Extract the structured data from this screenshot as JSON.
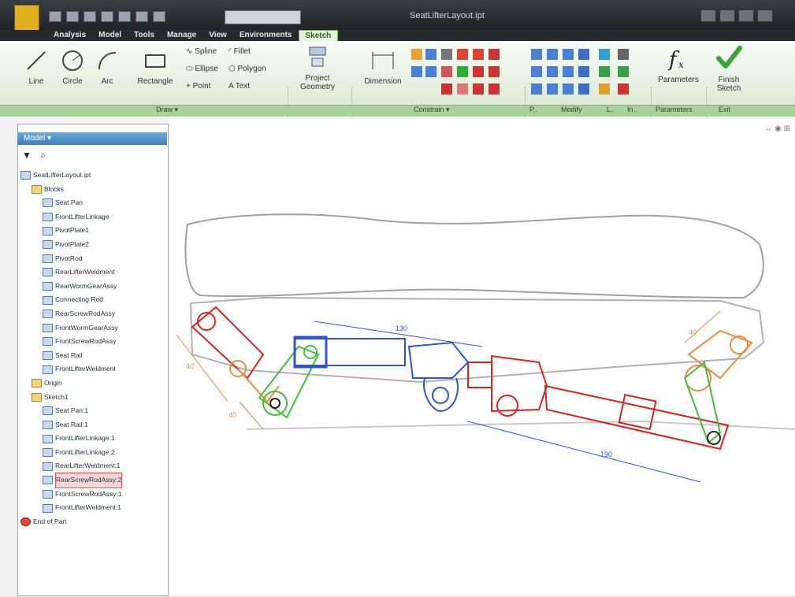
{
  "window": {
    "title": "SeatLifterLayout.ipt"
  },
  "ribbon_tabs": [
    "Analysis",
    "Model",
    "Tools",
    "Manage",
    "View",
    "Environments",
    "Sketch"
  ],
  "ribbon": {
    "draw": {
      "line": "Line",
      "circle": "Circle",
      "arc": "Arc",
      "rectangle": "Rectangle",
      "spline": "Spline",
      "fillet": "Fillet",
      "ellipse": "Ellipse",
      "polygon": "Polygon",
      "point": "Point",
      "text": "Text",
      "project_geometry": "Project Geometry"
    },
    "constrain": {
      "dimension": "Dimension"
    },
    "parameters": "Parameters",
    "finish_sketch": "Finish Sketch"
  },
  "panels": {
    "draw": "Draw ▾",
    "constrain": "Constrain ▾",
    "pattern": "P..",
    "modify": "Modify",
    "layout": "L..",
    "insert": "In..",
    "parameters": "Parameters",
    "exit": "Exit"
  },
  "browser": {
    "title": "Model ▾",
    "items": [
      {
        "label": "SeatLifterLayout.ipt",
        "indent": 0,
        "type": "part"
      },
      {
        "label": "Blocks",
        "indent": 1,
        "type": "folder"
      },
      {
        "label": "Seat Pan",
        "indent": 2,
        "type": "block"
      },
      {
        "label": "FrontLifterLinkage",
        "indent": 2,
        "type": "block"
      },
      {
        "label": "PivotPlate1",
        "indent": 2,
        "type": "block"
      },
      {
        "label": "PivotPlate2",
        "indent": 2,
        "type": "block"
      },
      {
        "label": "PivotRod",
        "indent": 2,
        "type": "block"
      },
      {
        "label": "RearLifterWeldment",
        "indent": 2,
        "type": "block"
      },
      {
        "label": "RearWormGearAssy",
        "indent": 2,
        "type": "block"
      },
      {
        "label": "Connecting Rod",
        "indent": 2,
        "type": "block"
      },
      {
        "label": "RearScrewRodAssy",
        "indent": 2,
        "type": "block"
      },
      {
        "label": "FrontWormGearAssy",
        "indent": 2,
        "type": "block"
      },
      {
        "label": "FrontScrewRodAssy",
        "indent": 2,
        "type": "block"
      },
      {
        "label": "Seat Rail",
        "indent": 2,
        "type": "block"
      },
      {
        "label": "FrontLifterWeldment",
        "indent": 2,
        "type": "block"
      },
      {
        "label": "Origin",
        "indent": 1,
        "type": "folder"
      },
      {
        "label": "Sketch1",
        "indent": 1,
        "type": "folder"
      },
      {
        "label": "Seat Pan:1",
        "indent": 2,
        "type": "block"
      },
      {
        "label": "Seat Rail:1",
        "indent": 2,
        "type": "block"
      },
      {
        "label": "FrontLifterLinkage:1",
        "indent": 2,
        "type": "block"
      },
      {
        "label": "FrontLifterLinkage:2",
        "indent": 2,
        "type": "block"
      },
      {
        "label": "RearLifterWeldment:1",
        "indent": 2,
        "type": "block"
      },
      {
        "label": "RearScrewRodAssy:2",
        "indent": 2,
        "type": "block",
        "selected": true
      },
      {
        "label": "FrontScrewRodAssy:1",
        "indent": 2,
        "type": "block"
      },
      {
        "label": "FrontLifterWeldment:1",
        "indent": 2,
        "type": "block"
      },
      {
        "label": "End of Part",
        "indent": 0,
        "type": "end"
      }
    ]
  },
  "dimensions": [
    "130",
    "190",
    "40",
    "40",
    "40"
  ],
  "colors": {
    "ribbon_green": "#a9d39a",
    "blue": "#2b55d6",
    "red": "#e0201d",
    "orange": "#f08a3c",
    "green": "#3fc23a"
  }
}
